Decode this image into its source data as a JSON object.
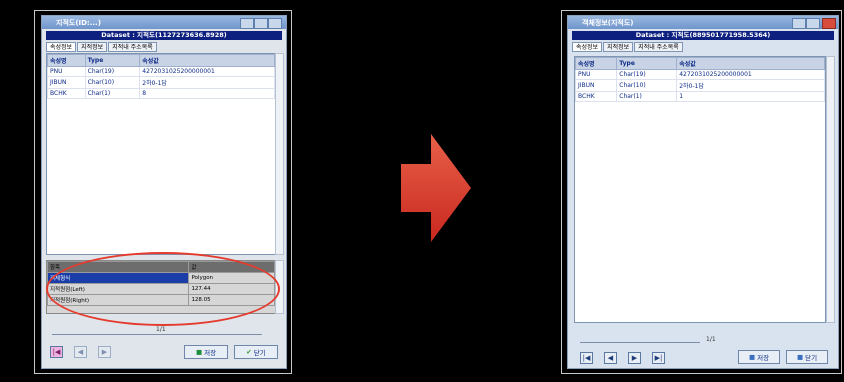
{
  "left": {
    "title": "지적도(ID:...)",
    "dataset": "Dataset : 지적도(1127273636.8928)",
    "tabs": [
      "속성정보",
      "지적정보",
      "지적내 주소목록"
    ],
    "columns": [
      "속성명",
      "Type",
      "속성값"
    ],
    "rows": [
      [
        "PNU",
        "Char(19)",
        "4272031025200000001"
      ],
      [
        "JIBUN",
        "Char(10)",
        "2하0-1답"
      ],
      [
        "BCHK",
        "Char(1)",
        "8"
      ]
    ],
    "props": {
      "header": [
        "항목",
        "값"
      ],
      "rows": [
        [
          "객체형식",
          "Polygon"
        ],
        [
          "지적원점(Left)",
          "127.44"
        ],
        [
          "지적원점(Right)",
          "128.05"
        ]
      ]
    },
    "page": "1/1",
    "save_label": "저장",
    "close_label": "닫기"
  },
  "right": {
    "title": "객체정보(지적도)",
    "dataset": "Dataset : 지적도(889501771958.5364)",
    "tabs": [
      "속성정보",
      "지적정보",
      "지적내 주소목록"
    ],
    "columns": [
      "속성명",
      "Type",
      "속성값"
    ],
    "rows": [
      [
        "PNU",
        "Char(19)",
        "4272031025200000001"
      ],
      [
        "JIBUN",
        "Char(10)",
        "2하0-1답"
      ],
      [
        "BCHK",
        "Char(1)",
        "1"
      ]
    ],
    "page": "1/1",
    "save_label": "저장",
    "close_label": "닫기"
  },
  "colors": {
    "accent": "#0d2080",
    "arrow": "#e0392e",
    "highlight": "#e53b2e"
  }
}
